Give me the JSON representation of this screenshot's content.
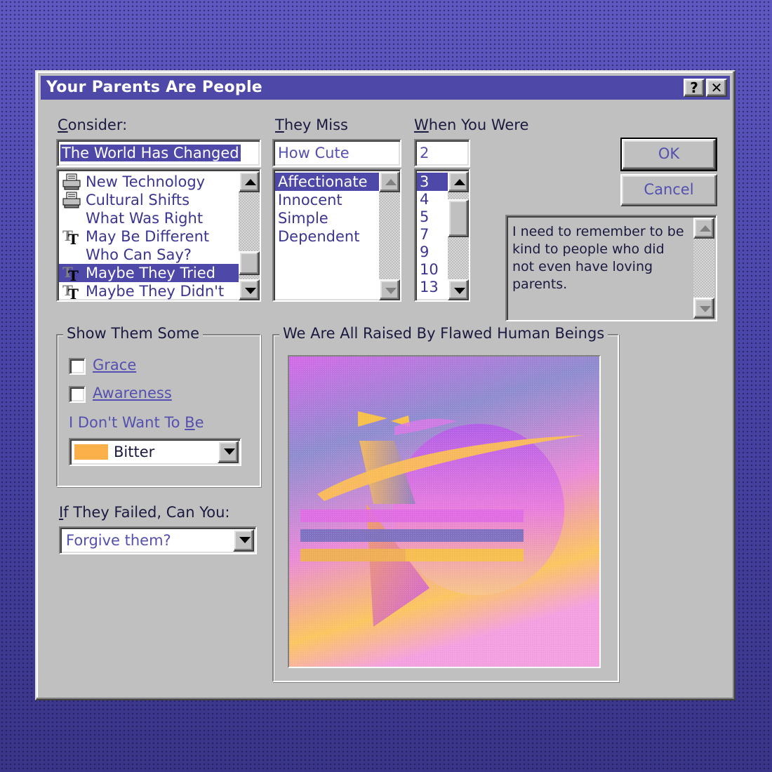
{
  "window": {
    "title": "Your Parents Are People",
    "help_button": "?",
    "close_button": "✕"
  },
  "consider": {
    "label": "Consider:",
    "value": "The World Has Changed",
    "items": [
      {
        "label": "New Technology",
        "icon": "printer-icon",
        "selected": false
      },
      {
        "label": "Cultural Shifts",
        "icon": "printer-icon",
        "selected": false
      },
      {
        "label": "What Was Right",
        "icon": "",
        "selected": false
      },
      {
        "label": "May Be Different",
        "icon": "truetype-font-icon",
        "selected": false
      },
      {
        "label": "Who Can Say?",
        "icon": "",
        "selected": false
      },
      {
        "label": "Maybe They Tried",
        "icon": "truetype-font-icon",
        "selected": true
      },
      {
        "label": "Maybe They Didn't",
        "icon": "truetype-font-icon",
        "selected": false
      }
    ]
  },
  "they_miss": {
    "label": "They Miss",
    "value": "How Cute",
    "items": [
      {
        "label": "Affectionate",
        "selected": true
      },
      {
        "label": "Innocent",
        "selected": false
      },
      {
        "label": "Simple",
        "selected": false
      },
      {
        "label": "Dependent",
        "selected": false
      }
    ]
  },
  "when_you_were": {
    "label": "When You Were",
    "value": "2",
    "items": [
      {
        "label": "3",
        "selected": true
      },
      {
        "label": "4",
        "selected": false
      },
      {
        "label": "5",
        "selected": false
      },
      {
        "label": "7",
        "selected": false
      },
      {
        "label": "9",
        "selected": false
      },
      {
        "label": "10",
        "selected": false
      },
      {
        "label": "13",
        "selected": false
      }
    ]
  },
  "buttons": {
    "ok": "OK",
    "cancel": "Cancel"
  },
  "note": {
    "text": "I need to remember to be kind to people who did not even have loving parents."
  },
  "show_them_some": {
    "legend": "Show Them Some",
    "options": [
      {
        "label": "Grace",
        "checked": false
      },
      {
        "label": "Awareness",
        "checked": false
      }
    ],
    "dont_want_label": "I Don't Want To Be",
    "dont_want_value": "Bitter",
    "swatch_color": "#fbb04a"
  },
  "if_failed": {
    "label": "If They Failed, Can You:",
    "value": "Forgive them?"
  },
  "preview": {
    "legend": "We Are All Raised By Flawed Human Beings"
  },
  "colors": {
    "title_bar": "#4e48a8",
    "selection": "#4e48a8",
    "text_accent": "#5450b0",
    "face": "#c0c0c0"
  }
}
